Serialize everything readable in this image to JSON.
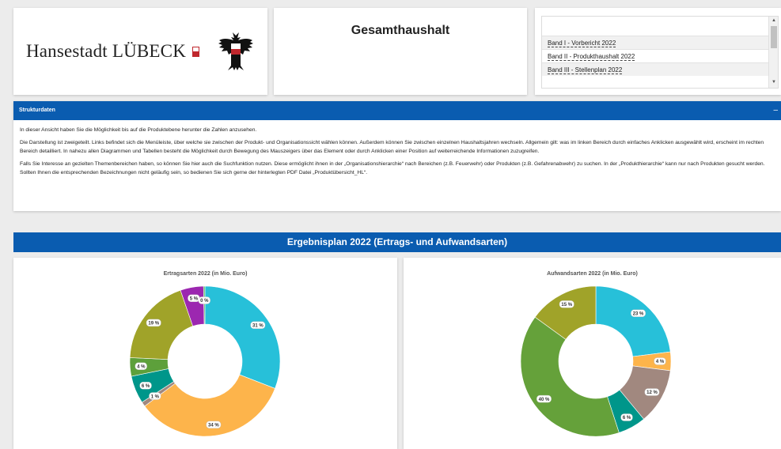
{
  "logo": {
    "text": "Hansestadt LÜBECK"
  },
  "title": "Gesamthaushalt",
  "documents": [
    "Band I - Vorbericht 2022",
    "Band II - Produkthaushalt 2022",
    "Band III - Stellenplan 2022"
  ],
  "structure": {
    "header": "Strukturdaten",
    "collapse_label": "–",
    "p1": "In dieser Ansicht haben Sie die Möglichkeit bis auf die Produktebene herunter die Zahlen anzusehen.",
    "p2": "Die Darstellung ist zweigeteilt. Links befindet sich die Menüleiste, über welche sie zwischen der Produkt- und Organisationssicht wählen können. Außerdem können Sie zwischen einzelnen Haushaltsjahren wechseln. Allgemein gilt: was im linken Bereich durch einfaches Anklicken ausgewählt wird, erscheint im rechten Bereich detailliert. In nahezu allen Diagrammen und Tabellen besteht die Möglichkeit durch Bewegung des Mauszeigers über das Element oder durch Anklicken einer Position auf weiterreichende Informationen zuzugreifen.",
    "p3": "Falls Sie Interesse an gezielten Themenbereichen haben, so können Sie hier auch die Suchfunktion nutzen. Diese ermöglicht ihnen in der „Organisationshierarchie“ nach Bereichen (z.B. Feuerwehr) oder Produkten (z.B. Gefahrenabwehr) zu suchen. In der „Produkthierarchie“ kann nur nach Produkten gesucht werden. Sollten Ihnen die entsprechenden Bezeichnungen nicht geläufig sein, so bedienen Sie sich gerne der hinterlegten PDF Datei „Produktübersicht_HL“."
  },
  "plan_title": "Ergebnisplan 2022 (Ertrags- und Aufwandsarten)",
  "colors": {
    "accent": "#0a5cb0"
  },
  "chart_data": [
    {
      "type": "pie",
      "title": "Ertragsarten 2022 (in Mio. Euro)",
      "slices": [
        {
          "value": 31,
          "label": "31 %",
          "color": "#27c0d9"
        },
        {
          "value": 34,
          "label": "34 %",
          "color": "#fdb44b"
        },
        {
          "value": 1,
          "label": "1 %",
          "color": "#a1887f"
        },
        {
          "value": 6,
          "label": "6 %",
          "color": "#00968a"
        },
        {
          "value": 4,
          "label": "4 %",
          "color": "#5da03b"
        },
        {
          "value": 19,
          "label": "19 %",
          "color": "#a0a329"
        },
        {
          "value": 5,
          "label": "5 %",
          "color": "#9c27b0"
        },
        {
          "value": 0.3,
          "label": "0 %",
          "color": "#4caf50"
        }
      ]
    },
    {
      "type": "pie",
      "title": "Aufwandsarten 2022 (in Mio. Euro)",
      "slices": [
        {
          "value": 23,
          "label": "23 %",
          "color": "#27c0d9"
        },
        {
          "value": 4,
          "label": "4 %",
          "color": "#fdb44b"
        },
        {
          "value": 12,
          "label": "12 %",
          "color": "#a1887f"
        },
        {
          "value": 6,
          "label": "6 %",
          "color": "#00968a"
        },
        {
          "value": 40,
          "label": "40 %",
          "color": "#65a13a"
        },
        {
          "value": 15,
          "label": "15 %",
          "color": "#a0a329"
        }
      ]
    }
  ]
}
